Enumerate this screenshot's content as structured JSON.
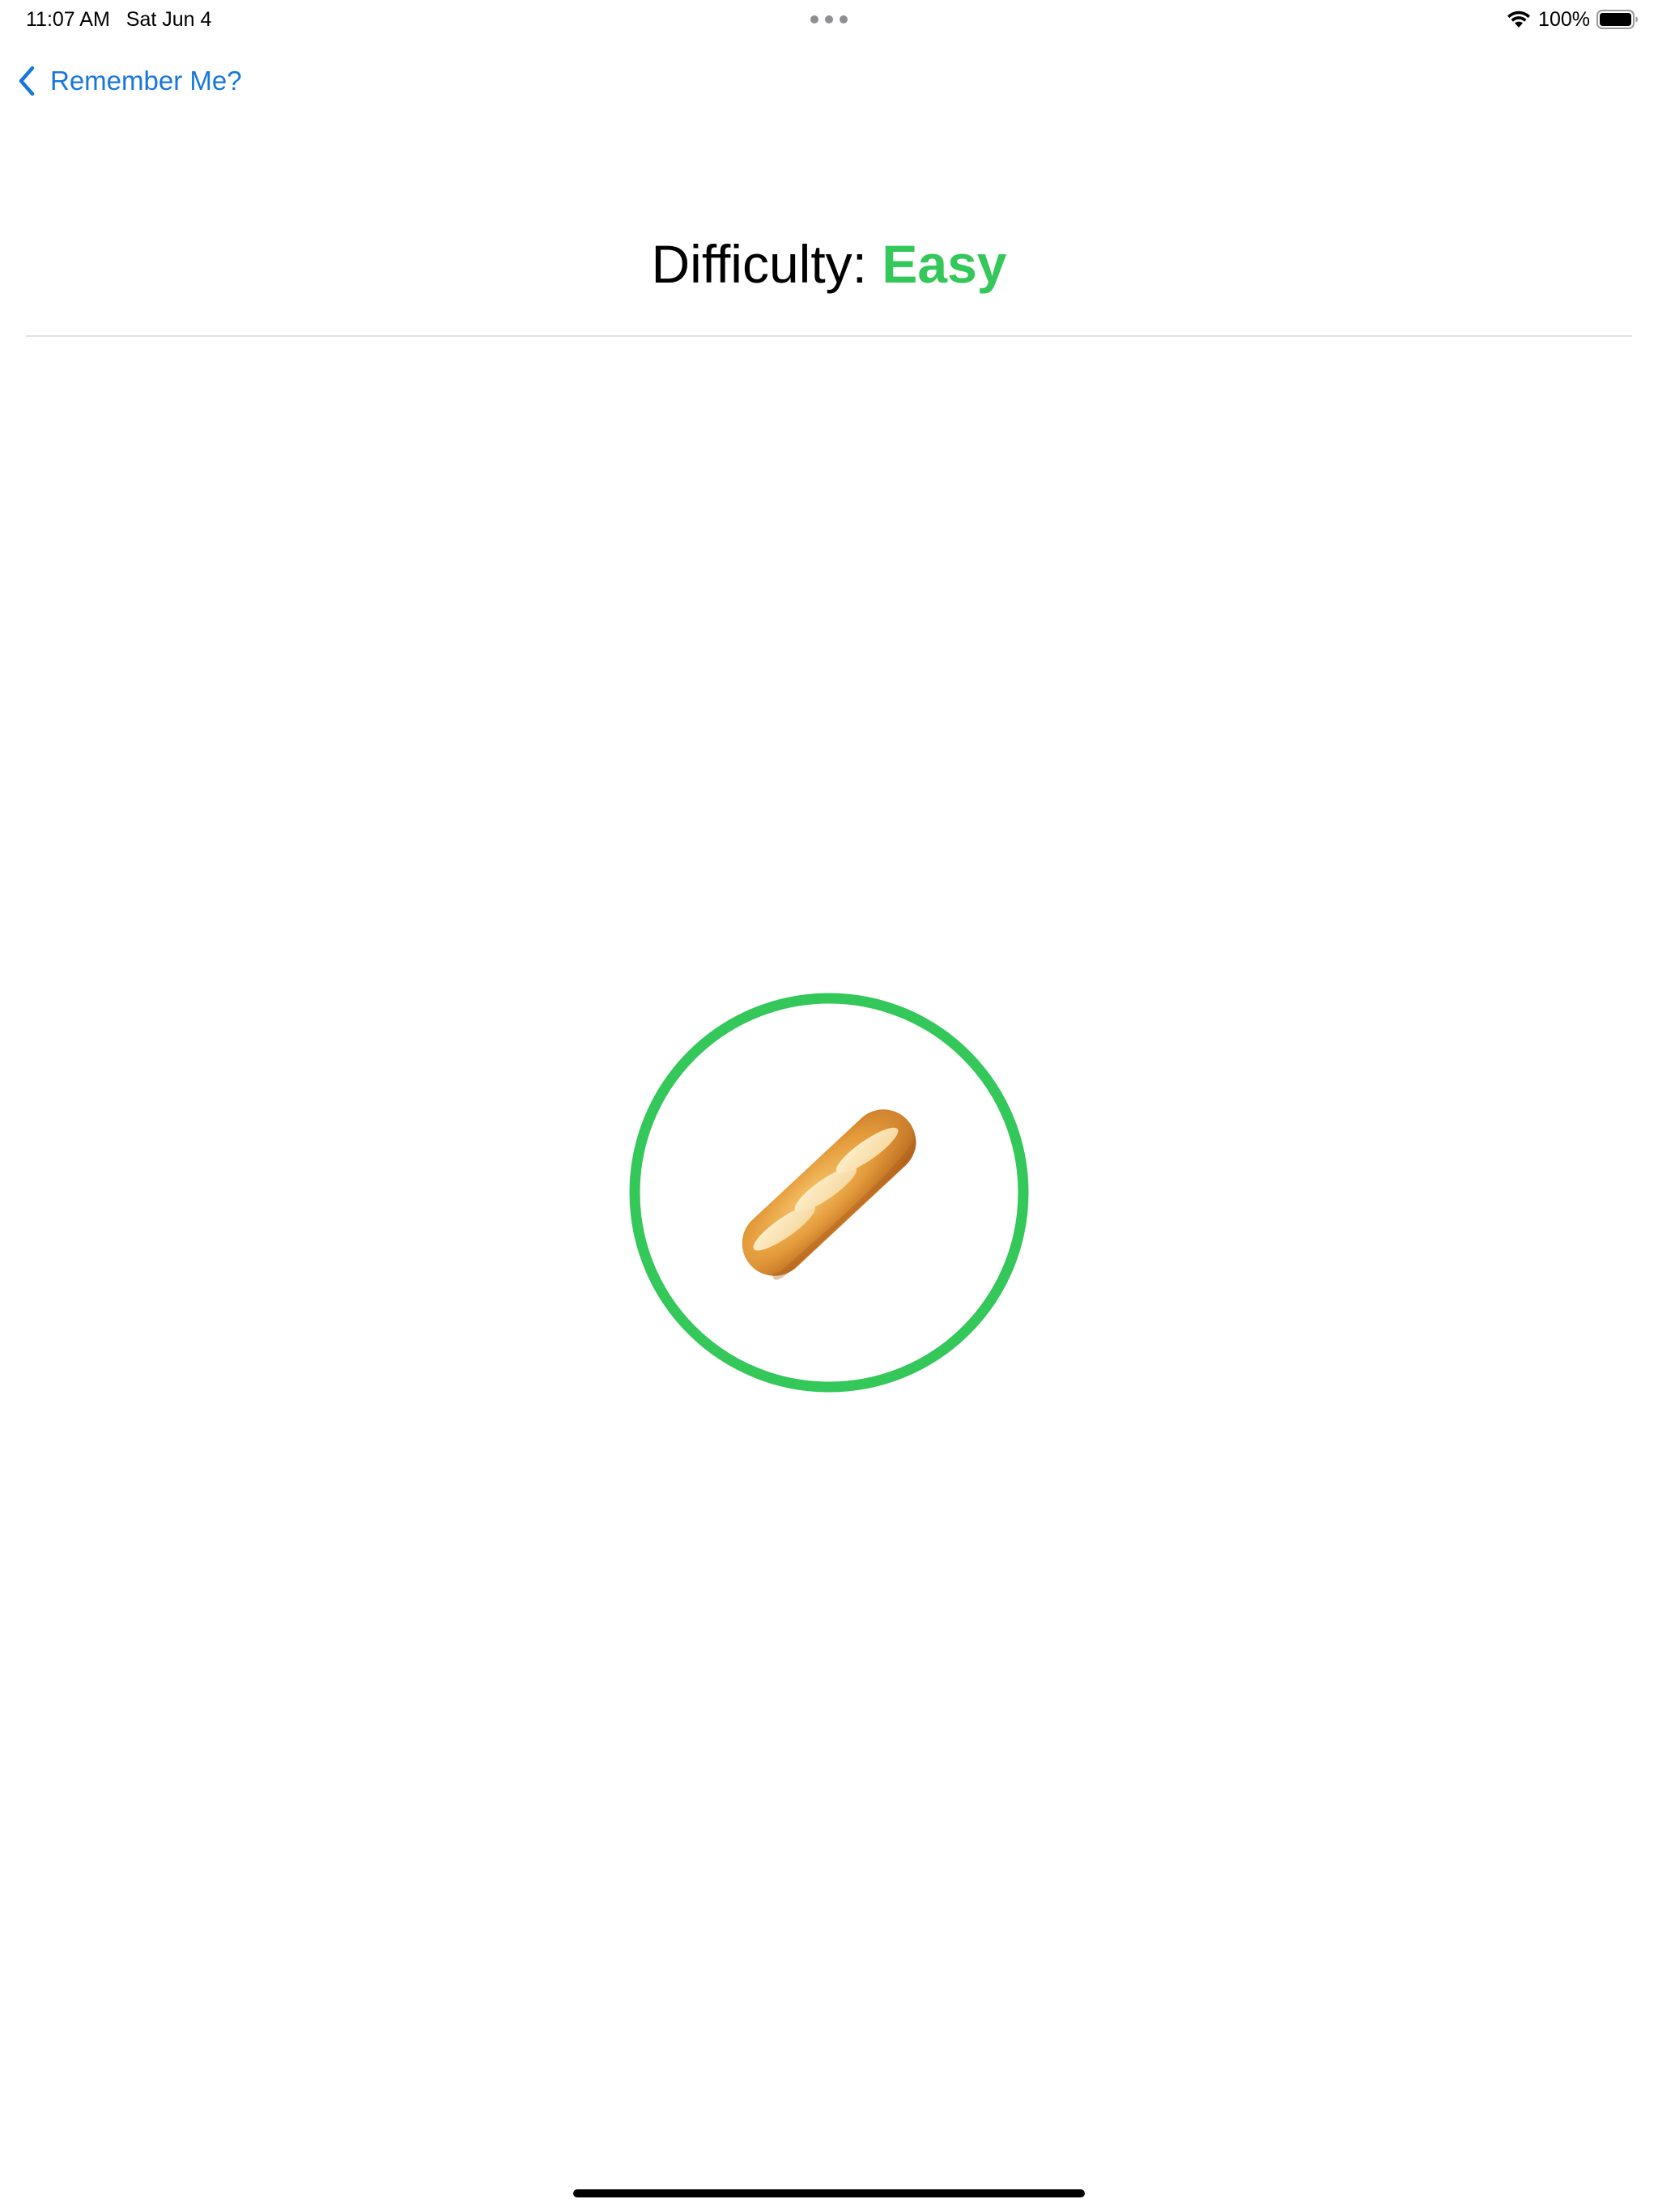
{
  "status_bar": {
    "time": "11:07 AM",
    "date": "Sat Jun 4",
    "battery_percent": "100%",
    "battery_level": 1.0,
    "wifi_icon": "wifi-icon",
    "battery_icon": "battery-icon"
  },
  "nav": {
    "back_label": "Remember Me?",
    "back_icon": "chevron-left-icon"
  },
  "title": {
    "prefix": "Difficulty: ",
    "value": "Easy"
  },
  "card": {
    "emoji_name": "baguette-bread-icon"
  },
  "colors": {
    "accent": "#1877DB",
    "easy": "#34C759",
    "divider": "#E2E2E4"
  }
}
